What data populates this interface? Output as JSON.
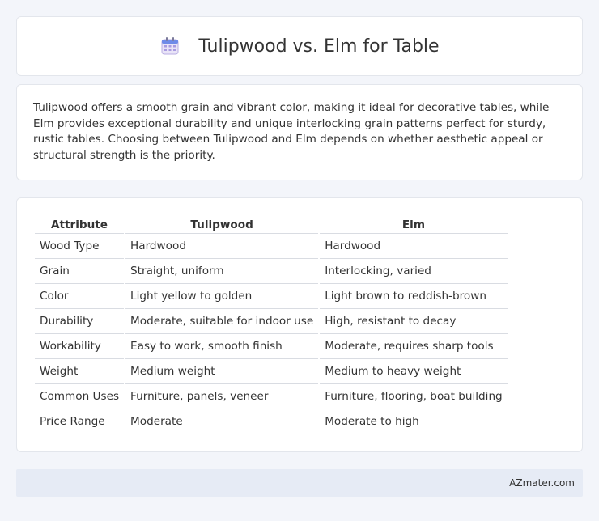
{
  "header": {
    "title": "Tulipwood vs. Elm for Table",
    "icon": "calendar-icon"
  },
  "description": "Tulipwood offers a smooth grain and vibrant color, making it ideal for decorative tables, while Elm provides exceptional durability and unique interlocking grain patterns perfect for sturdy, rustic tables. Choosing between Tulipwood and Elm depends on whether aesthetic appeal or structural strength is the priority.",
  "table": {
    "headers": [
      "Attribute",
      "Tulipwood",
      "Elm"
    ],
    "rows": [
      [
        "Wood Type",
        "Hardwood",
        "Hardwood"
      ],
      [
        "Grain",
        "Straight, uniform",
        "Interlocking, varied"
      ],
      [
        "Color",
        "Light yellow to golden",
        "Light brown to reddish-brown"
      ],
      [
        "Durability",
        "Moderate, suitable for indoor use",
        "High, resistant to decay"
      ],
      [
        "Workability",
        "Easy to work, smooth finish",
        "Moderate, requires sharp tools"
      ],
      [
        "Weight",
        "Medium weight",
        "Medium to heavy weight"
      ],
      [
        "Common Uses",
        "Furniture, panels, veneer",
        "Furniture, flooring, boat building"
      ],
      [
        "Price Range",
        "Moderate",
        "Moderate to high"
      ]
    ]
  },
  "footer": {
    "brand": "AZmater.com"
  }
}
